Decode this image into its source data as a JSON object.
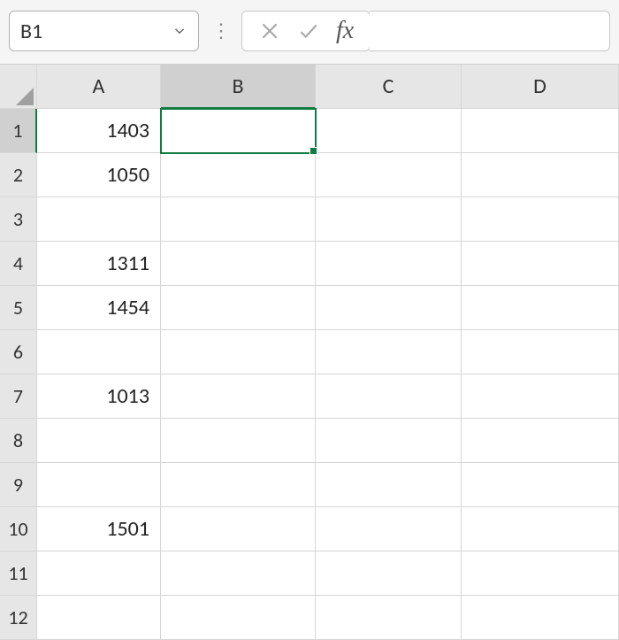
{
  "formulaBar": {
    "nameBox": "B1",
    "fxLabel": "fx",
    "formulaValue": ""
  },
  "columns": [
    "A",
    "B",
    "C",
    "D"
  ],
  "rowCount": 12,
  "selectedCell": {
    "col": "B",
    "row": 1
  },
  "cells": {
    "A1": "1403",
    "A2": "1050",
    "A4": "1311",
    "A5": "1454",
    "A7": "1013",
    "A10": "1501"
  }
}
